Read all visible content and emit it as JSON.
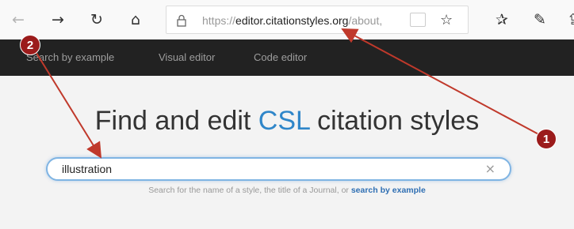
{
  "browser": {
    "back_icon": "←",
    "forward_icon": "→",
    "refresh_icon": "↻",
    "home_icon": "⌂",
    "url_prefix": "https://",
    "url_domain": "editor.citationstyles.org",
    "url_path": "/about,",
    "star_icon": "☆",
    "favorites_icon": "✰",
    "pen_icon": "✎",
    "share_icon": "⇪"
  },
  "nav": {
    "items": [
      "Search by example",
      "Visual editor",
      "Code editor"
    ]
  },
  "main": {
    "headline_before": "Find and edit ",
    "headline_accent": "CSL",
    "headline_after": " citation styles",
    "search_value": "illustration",
    "clear_icon": "×",
    "help_text": "Search for the name of a style, the title of a Journal, or",
    "help_link": "search by example"
  },
  "annotations": {
    "badge_1": "1",
    "badge_2": "2",
    "color": "#9b1b1b"
  },
  "colors": {
    "nav_bg": "#222222",
    "accent": "#2f86c9",
    "link": "#2f6fb3"
  }
}
